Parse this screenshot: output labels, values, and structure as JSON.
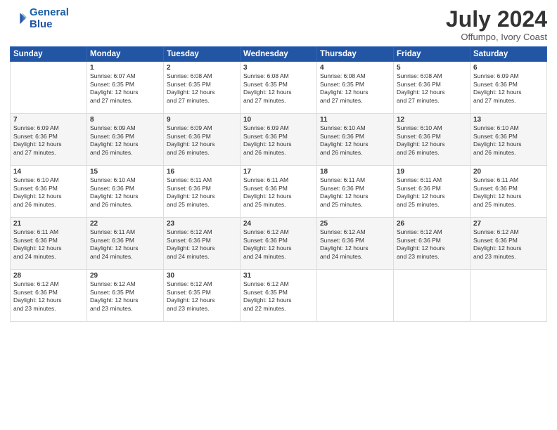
{
  "header": {
    "logo_line1": "General",
    "logo_line2": "Blue",
    "month_year": "July 2024",
    "location": "Offumpo, Ivory Coast"
  },
  "days_of_week": [
    "Sunday",
    "Monday",
    "Tuesday",
    "Wednesday",
    "Thursday",
    "Friday",
    "Saturday"
  ],
  "weeks": [
    [
      {
        "day": "",
        "info": ""
      },
      {
        "day": "1",
        "info": "Sunrise: 6:07 AM\nSunset: 6:35 PM\nDaylight: 12 hours\nand 27 minutes."
      },
      {
        "day": "2",
        "info": "Sunrise: 6:08 AM\nSunset: 6:35 PM\nDaylight: 12 hours\nand 27 minutes."
      },
      {
        "day": "3",
        "info": "Sunrise: 6:08 AM\nSunset: 6:35 PM\nDaylight: 12 hours\nand 27 minutes."
      },
      {
        "day": "4",
        "info": "Sunrise: 6:08 AM\nSunset: 6:35 PM\nDaylight: 12 hours\nand 27 minutes."
      },
      {
        "day": "5",
        "info": "Sunrise: 6:08 AM\nSunset: 6:36 PM\nDaylight: 12 hours\nand 27 minutes."
      },
      {
        "day": "6",
        "info": "Sunrise: 6:09 AM\nSunset: 6:36 PM\nDaylight: 12 hours\nand 27 minutes."
      }
    ],
    [
      {
        "day": "7",
        "info": "Sunrise: 6:09 AM\nSunset: 6:36 PM\nDaylight: 12 hours\nand 27 minutes."
      },
      {
        "day": "8",
        "info": "Sunrise: 6:09 AM\nSunset: 6:36 PM\nDaylight: 12 hours\nand 26 minutes."
      },
      {
        "day": "9",
        "info": "Sunrise: 6:09 AM\nSunset: 6:36 PM\nDaylight: 12 hours\nand 26 minutes."
      },
      {
        "day": "10",
        "info": "Sunrise: 6:09 AM\nSunset: 6:36 PM\nDaylight: 12 hours\nand 26 minutes."
      },
      {
        "day": "11",
        "info": "Sunrise: 6:10 AM\nSunset: 6:36 PM\nDaylight: 12 hours\nand 26 minutes."
      },
      {
        "day": "12",
        "info": "Sunrise: 6:10 AM\nSunset: 6:36 PM\nDaylight: 12 hours\nand 26 minutes."
      },
      {
        "day": "13",
        "info": "Sunrise: 6:10 AM\nSunset: 6:36 PM\nDaylight: 12 hours\nand 26 minutes."
      }
    ],
    [
      {
        "day": "14",
        "info": "Sunrise: 6:10 AM\nSunset: 6:36 PM\nDaylight: 12 hours\nand 26 minutes."
      },
      {
        "day": "15",
        "info": "Sunrise: 6:10 AM\nSunset: 6:36 PM\nDaylight: 12 hours\nand 26 minutes."
      },
      {
        "day": "16",
        "info": "Sunrise: 6:11 AM\nSunset: 6:36 PM\nDaylight: 12 hours\nand 25 minutes."
      },
      {
        "day": "17",
        "info": "Sunrise: 6:11 AM\nSunset: 6:36 PM\nDaylight: 12 hours\nand 25 minutes."
      },
      {
        "day": "18",
        "info": "Sunrise: 6:11 AM\nSunset: 6:36 PM\nDaylight: 12 hours\nand 25 minutes."
      },
      {
        "day": "19",
        "info": "Sunrise: 6:11 AM\nSunset: 6:36 PM\nDaylight: 12 hours\nand 25 minutes."
      },
      {
        "day": "20",
        "info": "Sunrise: 6:11 AM\nSunset: 6:36 PM\nDaylight: 12 hours\nand 25 minutes."
      }
    ],
    [
      {
        "day": "21",
        "info": "Sunrise: 6:11 AM\nSunset: 6:36 PM\nDaylight: 12 hours\nand 24 minutes."
      },
      {
        "day": "22",
        "info": "Sunrise: 6:11 AM\nSunset: 6:36 PM\nDaylight: 12 hours\nand 24 minutes."
      },
      {
        "day": "23",
        "info": "Sunrise: 6:12 AM\nSunset: 6:36 PM\nDaylight: 12 hours\nand 24 minutes."
      },
      {
        "day": "24",
        "info": "Sunrise: 6:12 AM\nSunset: 6:36 PM\nDaylight: 12 hours\nand 24 minutes."
      },
      {
        "day": "25",
        "info": "Sunrise: 6:12 AM\nSunset: 6:36 PM\nDaylight: 12 hours\nand 24 minutes."
      },
      {
        "day": "26",
        "info": "Sunrise: 6:12 AM\nSunset: 6:36 PM\nDaylight: 12 hours\nand 23 minutes."
      },
      {
        "day": "27",
        "info": "Sunrise: 6:12 AM\nSunset: 6:36 PM\nDaylight: 12 hours\nand 23 minutes."
      }
    ],
    [
      {
        "day": "28",
        "info": "Sunrise: 6:12 AM\nSunset: 6:36 PM\nDaylight: 12 hours\nand 23 minutes."
      },
      {
        "day": "29",
        "info": "Sunrise: 6:12 AM\nSunset: 6:35 PM\nDaylight: 12 hours\nand 23 minutes."
      },
      {
        "day": "30",
        "info": "Sunrise: 6:12 AM\nSunset: 6:35 PM\nDaylight: 12 hours\nand 23 minutes."
      },
      {
        "day": "31",
        "info": "Sunrise: 6:12 AM\nSunset: 6:35 PM\nDaylight: 12 hours\nand 22 minutes."
      },
      {
        "day": "",
        "info": ""
      },
      {
        "day": "",
        "info": ""
      },
      {
        "day": "",
        "info": ""
      }
    ]
  ]
}
